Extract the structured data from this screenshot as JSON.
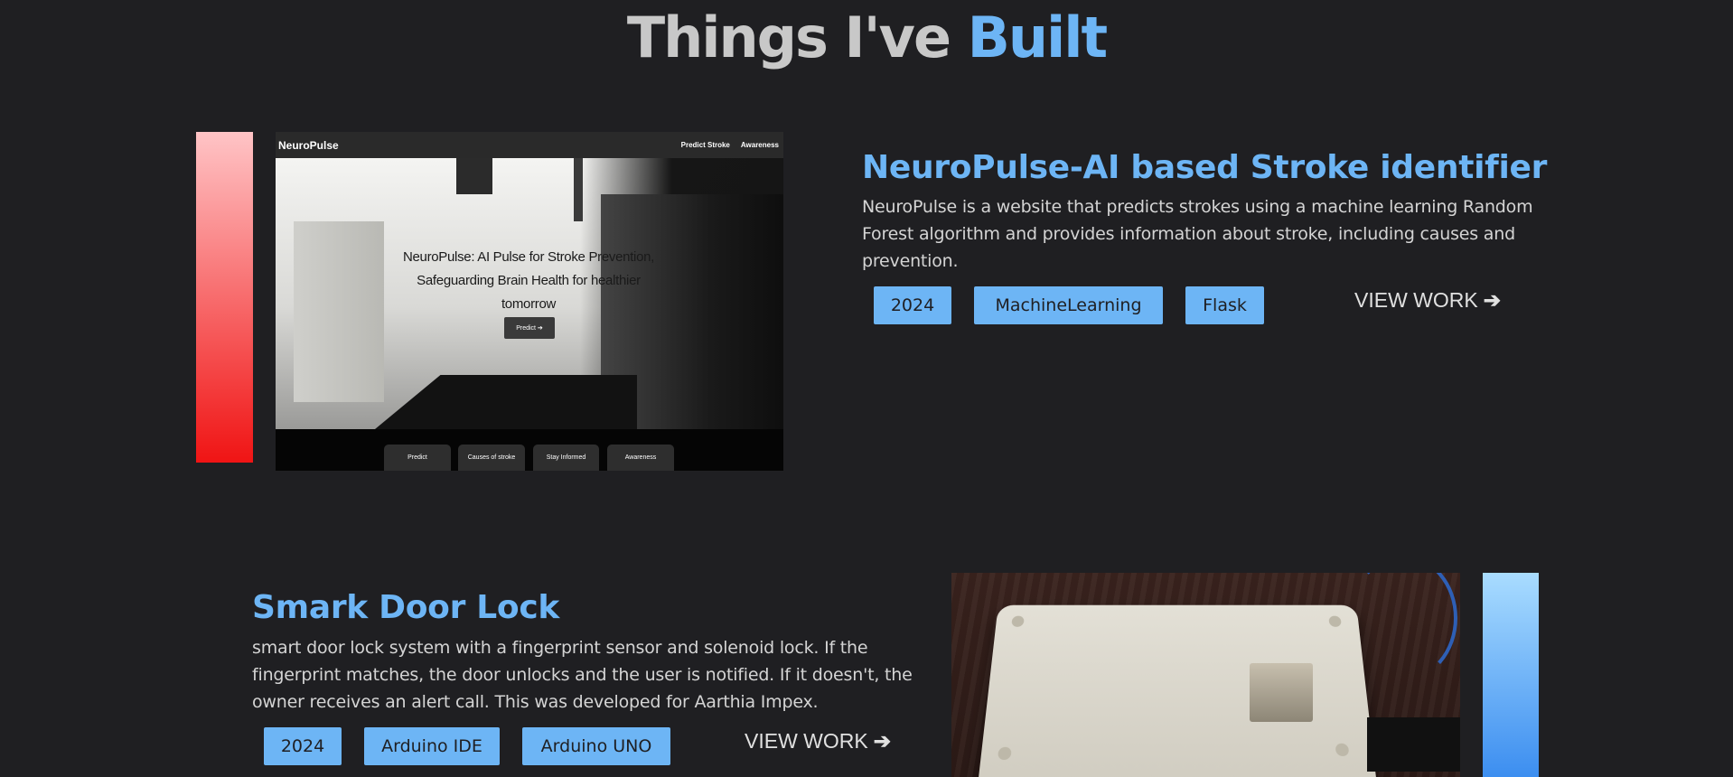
{
  "section": {
    "title_main": "Things I've",
    "title_accent": "Built"
  },
  "projects": [
    {
      "title": "NeuroPulse-AI based Stroke identifier",
      "description": "NeuroPulse is a website that predicts strokes using a machine learning Random Forest algorithm and provides information about stroke, including causes and prevention.",
      "tags": [
        "2024",
        "MachineLearning",
        "Flask"
      ],
      "view_label": "VIEW WORK",
      "view_icon": "arrow-right-icon",
      "thumbnail": {
        "brand": "NeuroPulse",
        "nav": [
          "Predict Stroke",
          "Awareness"
        ],
        "hero_text": "NeuroPulse: AI Pulse for Stroke Prevention, Safeguarding Brain Health for healthier tomorrow",
        "button": "Predict ➔",
        "tabs": [
          "Predict",
          "Causes of stroke",
          "Stay Informed",
          "Awareness"
        ]
      },
      "accent_bar_color": "#f01414"
    },
    {
      "title": "Smark Door Lock",
      "description": "smart door lock system with a fingerprint sensor and solenoid lock. If the fingerprint matches, the door unlocks and the user is notified. If it doesn't, the owner receives an alert call. This was developed for Aarthia Impex.",
      "tags": [
        "2024",
        "Arduino IDE",
        "Arduino UNO"
      ],
      "view_label": "VIEW WORK",
      "view_icon": "arrow-right-icon",
      "accent_bar_color": "#3c8ef0"
    }
  ],
  "colors": {
    "background": "#1f1f22",
    "accent": "#6db5f5",
    "heading": "#c8c8c8"
  }
}
